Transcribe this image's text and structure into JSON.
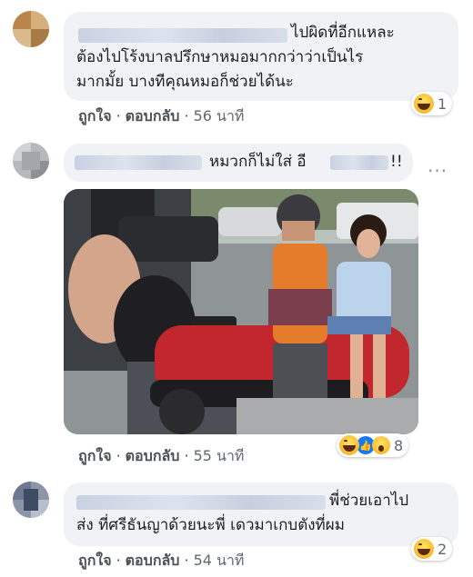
{
  "colors": {
    "bubble": "#f0f2f5",
    "action_text": "#4b4f56",
    "like_blue": "#1877f2",
    "haha_yellow": "#f7b928"
  },
  "comments": [
    {
      "text_lines": [
        "ไปผิดที่อีกแหละ",
        "ต้องไปโร้งบาลปรึกษาหมอมากกว่าว่าเป็นไร",
        "มากมั้ย บางทีคุณหมอก็ช่วยได้นะ"
      ],
      "like_label": "ถูกใจ",
      "reply_label": "ตอบกลับ",
      "time": "56 นาที",
      "reaction_count": "1",
      "reaction_icons": [
        "haha-icon"
      ]
    },
    {
      "text_lines": [
        "หมวกก็ไม่ใส่ อี",
        "!!"
      ],
      "more_label": "···",
      "like_label": "ถูกใจ",
      "reply_label": "ตอบกลับ",
      "time": "55 นาที",
      "reaction_count": "8",
      "reaction_icons": [
        "haha-icon",
        "like-icon",
        "wow-icon"
      ]
    },
    {
      "text_lines": [
        "พี่ช่วยเอาไป",
        "ส่ง ที่ศรีธันญาด้วยนะพี่ เดวมาเกบตังที่ผม"
      ],
      "like_label": "ถูกใจ",
      "reply_label": "ตอบกลับ",
      "time": "54 นาที",
      "reaction_count": "2",
      "reaction_icons": [
        "haha-icon"
      ]
    }
  ]
}
